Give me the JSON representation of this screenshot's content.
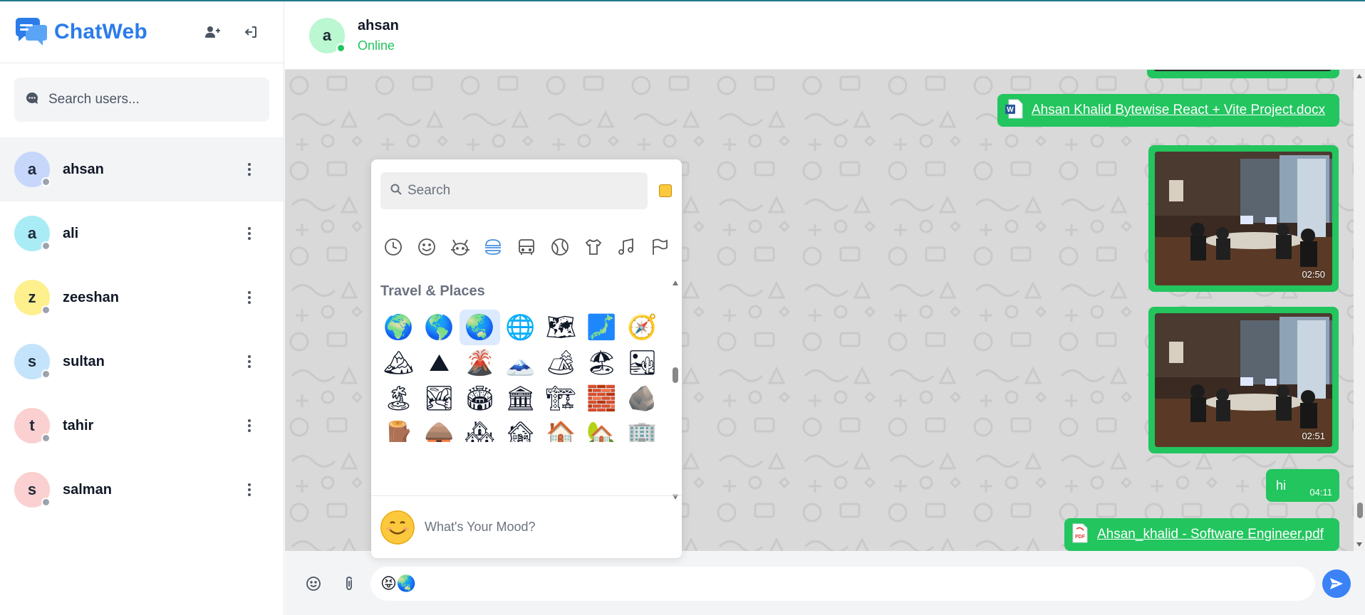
{
  "app": {
    "name": "ChatWeb",
    "accent": "#2b7ce9"
  },
  "sidebar": {
    "search_placeholder": "Search users...",
    "actions": [
      "add-user-icon",
      "logout-icon"
    ],
    "users": [
      {
        "initial": "a",
        "name": "ahsan",
        "avatar_color": "#c7d7fb",
        "active": true
      },
      {
        "initial": "a",
        "name": "ali",
        "avatar_color": "#a9ecf5"
      },
      {
        "initial": "z",
        "name": "zeeshan",
        "avatar_color": "#fdf08d"
      },
      {
        "initial": "s",
        "name": "sultan",
        "avatar_color": "#c4e4fb"
      },
      {
        "initial": "t",
        "name": "tahir",
        "avatar_color": "#fbd0d0"
      },
      {
        "initial": "s",
        "name": "salman",
        "avatar_color": "#fbd0d0"
      }
    ]
  },
  "chat": {
    "contact_initial": "a",
    "contact_name": "ahsan",
    "contact_status": "Online",
    "messages": [
      {
        "type": "file",
        "file_type": "docx",
        "name": "Ahsan Khalid Bytewise React + Vite Project.docx"
      },
      {
        "type": "image",
        "time": "02:50"
      },
      {
        "type": "image",
        "time": "02:51"
      },
      {
        "type": "text",
        "text": "hi",
        "time": "04:11"
      },
      {
        "type": "file",
        "file_type": "pdf",
        "name": "Ahsan_khalid - Software Engineer.pdf"
      }
    ],
    "bubble_color": "#22c55e"
  },
  "emoji_picker": {
    "search_placeholder": "Search",
    "category_title": "Travel & Places",
    "categories": [
      "recent-icon",
      "smiley-icon",
      "animal-icon",
      "food-icon",
      "travel-icon",
      "activity-icon",
      "objects-icon",
      "symbols-icon",
      "flags-icon"
    ],
    "emojis": [
      "🌍",
      "🌎",
      "🌏",
      "🌐",
      "🗺",
      "🗾",
      "🧭",
      "🏔",
      "⛰",
      "🌋",
      "🗻",
      "🏕",
      "🏖",
      "🏜",
      "🏝",
      "🏞",
      "🏟",
      "🏛",
      "🏗",
      "🧱",
      "🪨",
      "🪵",
      "🛖",
      "🏘",
      "🏚",
      "🏠",
      "🏡",
      "🏢",
      "🏣",
      "🏤",
      "🏥",
      "🏦",
      "🏨",
      "🏩",
      "🏪"
    ],
    "selected_index": 2,
    "footer_text": "What's Your Mood?"
  },
  "composer": {
    "value": "😝🌏"
  }
}
